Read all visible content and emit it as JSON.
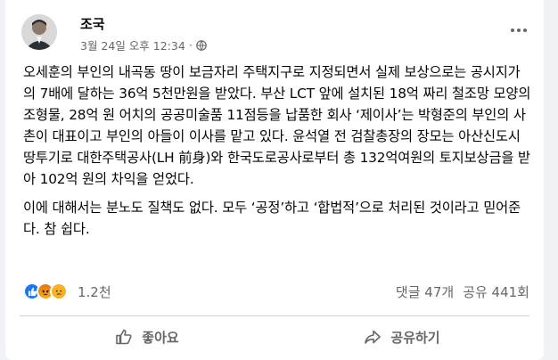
{
  "post": {
    "author": "조국",
    "timestamp": "3월 24일 오후 12:34",
    "privacy_icon": "globe-icon",
    "paragraphs": [
      "오세훈의 부인의 내곡동 땅이 보금자리 주택지구로 지정되면서 실제 보상으로는 공시지가의 7배에 달하는 36억 5천만원을 받았다. 부산 LCT 앞에 설치된 18억 짜리 철조망 모양의 조형물, 28억 원 어치의 공공미술품 11점등을 납품한  회사 ‘제이사’는 박형준의 부인의 사촌이 대표이고 부인의 아들이 이사를 맡고 있다. 윤석열 전 검찰총장의 장모는 아산신도시 땅투기로 대한주택공사(LH 前身)와 한국도로공사로부터 총 132억여원의 토지보상금을 받아 102억 원의 차익을 얻었다.",
      "이에 대해서는 분노도 질책도 없다. 모두 ‘공정’하고 ‘합법적’으로 처리된 것이라고 믿어준다. 참 쉽다."
    ]
  },
  "engagement": {
    "reaction_icons": [
      "like-icon",
      "angry-icon",
      "sad-icon"
    ],
    "reaction_count": "1.2천",
    "comments": "댓글 47개",
    "shares": "공유 441회"
  },
  "actions": {
    "like_label": "좋아요",
    "share_label": "공유하기"
  },
  "colors": {
    "accent": "#1877f2",
    "secondary_text": "#65676b",
    "background": "#f0f2f5"
  }
}
